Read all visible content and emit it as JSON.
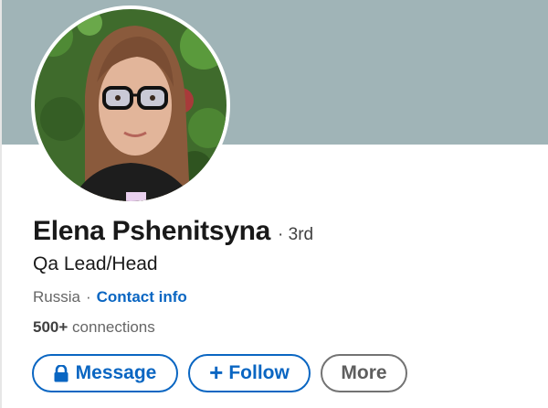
{
  "profile": {
    "name": "Elena Pshenitsyna",
    "degree": "· 3rd",
    "headline": "Qa Lead/Head",
    "location": "Russia",
    "separator": "·",
    "contact_info_label": "Contact info",
    "connections_count": "500+",
    "connections_label": "connections",
    "avatar_icon": "profile-photo"
  },
  "actions": {
    "message_label": "Message",
    "message_icon": "lock-icon",
    "follow_label": "Follow",
    "follow_icon": "plus-icon",
    "more_label": "More"
  },
  "colors": {
    "banner": "#a0b4b7",
    "link": "#0a66c2",
    "muted": "#666666",
    "text": "#191919"
  }
}
